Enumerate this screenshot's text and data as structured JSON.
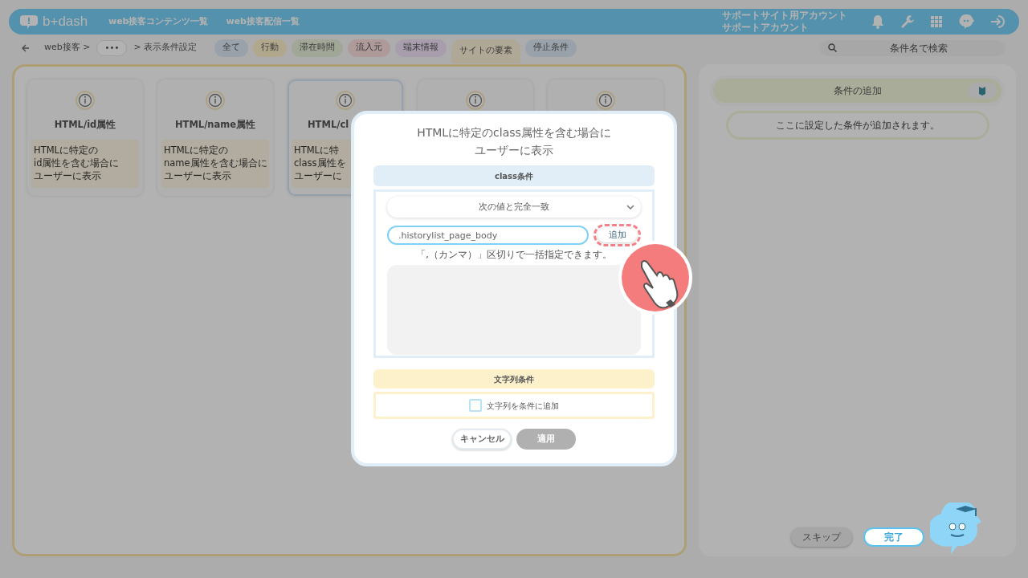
{
  "header": {
    "logo_text": "b+dash",
    "nav": [
      "web接客コンテンツ一覧",
      "web接客配信一覧"
    ],
    "account": [
      "サポートサイト用アカウント",
      "サポートアカウント"
    ]
  },
  "breadcrumb": {
    "first": "web接客 >",
    "more": "•••",
    "last": "> 表示条件設定"
  },
  "filters": [
    {
      "label": "全て",
      "color": "#99a2ab",
      "selected": false
    },
    {
      "label": "行動",
      "color": "#b0a78d",
      "selected": false
    },
    {
      "label": "滞在時間",
      "color": "#a1a796",
      "selected": false
    },
    {
      "label": "流入元",
      "color": "#af9a9a",
      "selected": false
    },
    {
      "label": "端末情報",
      "color": "#a79dac",
      "selected": false
    },
    {
      "label": "サイトの要素",
      "color": "#b0a896",
      "selected": true
    },
    {
      "label": "停止条件",
      "color": "#99a2ab",
      "selected": false
    }
  ],
  "search": {
    "placeholder": "条件名で検索"
  },
  "cards": [
    {
      "title": "HTML/id属性",
      "description": [
        "HTMLに特定の",
        "id属性を含む場合に",
        "ユーザーに表示"
      ],
      "selected": false
    },
    {
      "title": "HTML/name属性",
      "description": [
        "HTMLに特定の",
        "name属性を含む場合に",
        "ユーザーに表示"
      ],
      "selected": false
    },
    {
      "title": "HTML/cl",
      "description": [
        "HTMLに特",
        "class属性を",
        "ユーザーに"
      ],
      "selected": true
    },
    {
      "selected": false
    },
    {
      "selected": false
    }
  ],
  "right_panel": {
    "title": "条件の追加",
    "empty_text": "ここに設定した条件が追加されます。",
    "buttons": [
      {
        "label": "スキップ",
        "kind": "secondary"
      },
      {
        "label": "完了",
        "kind": "primary"
      }
    ]
  },
  "modal": {
    "title": [
      "HTMLに特定のclass属性を含む場合に",
      "ユーザーに表示"
    ],
    "class_section": {
      "heading": "class条件",
      "match": "次の値と完全一致",
      "value": ".historylist_page_body",
      "add_button": "追加",
      "hint": "「,（カンマ）」区切りで一括指定できます。"
    },
    "string_section": {
      "heading": "文字列条件",
      "checkbox": {
        "label": "文字列を条件に追加",
        "checked": false
      }
    },
    "buttons": [
      {
        "label": "キャンセル",
        "disabled": false
      },
      {
        "label": "適用",
        "disabled": true
      }
    ]
  }
}
